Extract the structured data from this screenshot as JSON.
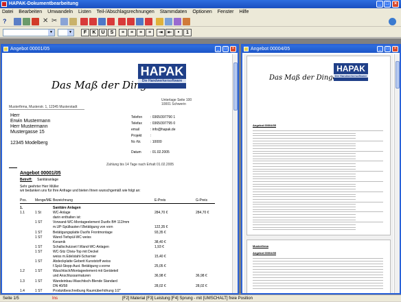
{
  "app": {
    "title": "HAPAK-Dokumentbearbeitung"
  },
  "menu": [
    "Datei",
    "Bearbeiten",
    "Umwandeln",
    "Listen",
    "Teil-/Abschlagsrechnungen",
    "Stammdaten",
    "Optionen",
    "Fenster",
    "Hilfe"
  ],
  "toolbar": {
    "icons": [
      "help-icon",
      "list-icon",
      "grid-icon",
      "stop-icon",
      "cut-icon",
      "scissors-icon",
      "copy-icon",
      "paste-icon",
      "text-a-icon",
      "text-b-icon",
      "text-c-icon",
      "text-d-icon",
      "text-a2-icon",
      "text-b2-icon",
      "text-c2-icon",
      "text-d2-icon",
      "flag-icon",
      "calc-icon",
      "print-icon",
      "gear-icon"
    ],
    "format_buttons": [
      "F",
      "K",
      "U",
      "S",
      "E",
      "E",
      "E",
      "E",
      "E",
      "E",
      "E",
      "E"
    ],
    "exit_icon": "exit-icon"
  },
  "windows": [
    {
      "title": "Angebot 00001/05",
      "logo": {
        "brand": "HAPAK",
        "tagline": "Die Handwerkersoftware",
        "slogan": "Das Maß der Dinge"
      },
      "sender_line": "Musterfirma, Musterstr. 1, 12345 Musterstadt",
      "address": [
        "Herr",
        "Erwin Mustermann",
        "Herr Mustermann",
        "Mustergasse 15",
        "",
        "12345 Modelberg"
      ],
      "contact": [
        [
          "Telefon",
          "0365/397790 1"
        ],
        [
          "Telefax",
          "0365/397795 0"
        ],
        [
          "email",
          "info@hapak.de"
        ],
        [
          "Projekt",
          ""
        ],
        [
          "Nr.-Nr.",
          "10000"
        ],
        [
          "Datum",
          "01.02.2005"
        ]
      ],
      "info_right": "Unterlage Seite 100\n10001 Schwerin",
      "date_line": "Zahlung bis 14 Tage nach Erhalt  01.02.2005",
      "heading": "Angebot 00001/05",
      "betreff_label": "Betreff:",
      "betreff_value": "Sanitäranlage",
      "salutation": "Sehr geehrter Herr Müller",
      "intro": "wir bedanken uns für Ihre Anfrage und bieten Ihnen wunschgemäß wie folgt an:",
      "table_headers": [
        "Pos.",
        "Menge/ME",
        "Bezeichnung",
        "E-Preis",
        "G-Preis"
      ],
      "rows": [
        [
          "1.",
          "",
          "Sanitäre Anlagen",
          "",
          ""
        ],
        [
          "1.1",
          "1 St",
          "WC-Anlage",
          "284,70 €",
          "284,70 €"
        ],
        [
          "",
          "",
          "darin enthalten ist:",
          "",
          ""
        ],
        [
          "",
          "1 ST",
          "Vorwand-WC-Montageelement Duofix BH 112/mm",
          "",
          ""
        ],
        [
          "",
          "",
          "m.UP-Spülkasten f.Betätigung von vorn",
          "122,35 €",
          ""
        ],
        [
          "",
          "1 ST",
          "Betätigungsplatte Duofix Frontmontage",
          "93,35 €",
          ""
        ],
        [
          "",
          "1 ST",
          "Wand-Tiefspül-WC weiss",
          "",
          ""
        ],
        [
          "",
          "",
          "Keramik",
          "38,40 €",
          ""
        ],
        [
          "",
          "1 ST",
          "Schallschutzset f.Wand-WC-Anlagen",
          "1,93 €",
          ""
        ],
        [
          "",
          "1 ST",
          "WC-Sitz Clivia-Top mit Deckel",
          "",
          ""
        ],
        [
          "",
          "",
          "weiss m.Edelstahl-Scharnier",
          "15,40 €",
          ""
        ],
        [
          "",
          "1 ST",
          "Abdeckplatte Geberit Kunststoff weiss",
          "",
          ""
        ],
        [
          "",
          "",
          "f.Spül-Stopp-Aust. Betätigung v.vorne",
          "25,05 €",
          ""
        ],
        [
          "1.2",
          "1 ST",
          "Waschtisch/Montageelement mit Geräteteil",
          "",
          ""
        ],
        [
          "",
          "",
          "und Anschlussarmaturen",
          "36,98 €",
          "36,98 €"
        ],
        [
          "1.3",
          "1 ST",
          "Wandeinbau-Waschtisch-Blende Standard",
          "",
          ""
        ],
        [
          "",
          "",
          "DN 40/58",
          "28,02 €",
          "28,02 €"
        ],
        [
          "1.4",
          "1 ST",
          "Produktbeschreibung Raumüberhöhung 1/2\"",
          "",
          ""
        ]
      ]
    },
    {
      "title": "Angebot 00004/05",
      "logo": {
        "brand": "HAPAK",
        "tagline": "Die Handwerkersoftware",
        "slogan": "Das Maß der Dinge"
      },
      "heading": "Angebot 00004/05",
      "heading2": "Musterfirma",
      "heading3": "Angebot 00004/05"
    }
  ],
  "status": {
    "page": "Seite 1/5",
    "mode": "Ins",
    "hints": "[F2] Material [F3] Leistung [F4] Sprung - mit [UMSCHALT] freie Position"
  }
}
